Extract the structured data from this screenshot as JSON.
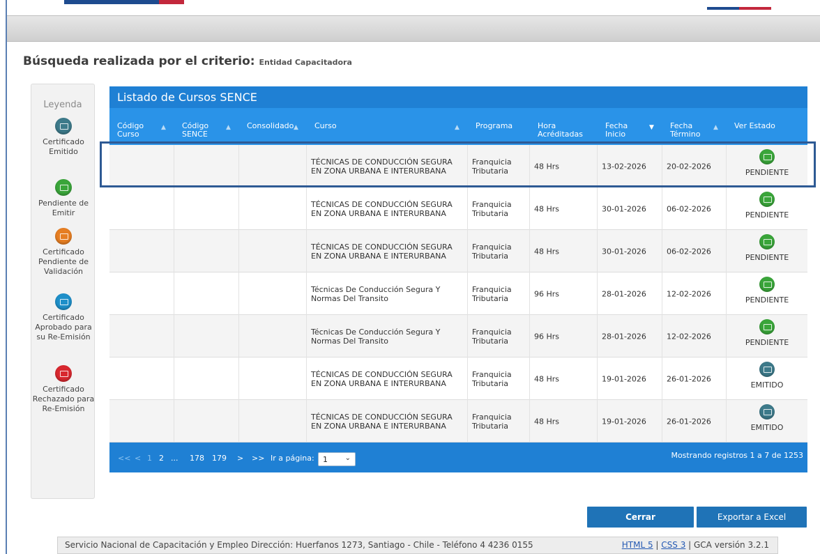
{
  "page": {
    "heading_main": "Búsqueda realizada por el criterio:",
    "heading_criterion": "Entidad Capacitadora"
  },
  "legend": {
    "title": "Leyenda",
    "items": [
      {
        "label": "Certificado Emitido",
        "color": "#3d7a8a",
        "icon": "certificate-emitted-icon"
      },
      {
        "label": "Pendiente de Emitir",
        "color": "#3aa53a",
        "icon": "certificate-pending-icon"
      },
      {
        "label": "Certificado Pendiente de Validación",
        "color": "#e67e22",
        "icon": "certificate-validation-icon"
      },
      {
        "label": "Certificado Aprobado para su Re-Emisión",
        "color": "#1e8fc9",
        "icon": "certificate-approved-icon"
      },
      {
        "label": "Certificado Rechazado para Re-Emisión",
        "color": "#d8282f",
        "icon": "certificate-rejected-icon"
      }
    ]
  },
  "table": {
    "title": "Listado de Cursos SENCE",
    "columns": [
      "Código Curso",
      "Código SENCE",
      "Consolidado",
      "Curso",
      "Programa",
      "Hora Acréditadas",
      "Fecha Inicio",
      "Fecha Término",
      "Ver Estado"
    ],
    "rows": [
      {
        "codigo_curso": "",
        "codigo_sence": "",
        "consolidado": "",
        "curso": "TÉCNICAS DE CONDUCCIÓN SEGURA EN ZONA URBANA E INTERURBANA",
        "programa": "Franquicia Tributaria",
        "horas": "48 Hrs",
        "inicio": "13-02-2026",
        "termino": "20-02-2026",
        "estado": "PENDIENTE",
        "estado_color": "#3aa53a"
      },
      {
        "codigo_curso": "",
        "codigo_sence": "",
        "consolidado": "",
        "curso": "TÉCNICAS DE CONDUCCIÓN SEGURA EN ZONA URBANA E INTERURBANA",
        "programa": "Franquicia Tributaria",
        "horas": "48 Hrs",
        "inicio": "30-01-2026",
        "termino": "06-02-2026",
        "estado": "PENDIENTE",
        "estado_color": "#3aa53a"
      },
      {
        "codigo_curso": "",
        "codigo_sence": "",
        "consolidado": "",
        "curso": "TÉCNICAS DE CONDUCCIÓN SEGURA EN ZONA URBANA E INTERURBANA",
        "programa": "Franquicia Tributaria",
        "horas": "48 Hrs",
        "inicio": "30-01-2026",
        "termino": "06-02-2026",
        "estado": "PENDIENTE",
        "estado_color": "#3aa53a"
      },
      {
        "codigo_curso": "",
        "codigo_sence": "",
        "consolidado": "",
        "curso": "Técnicas De Conducción Segura Y Normas Del Transito",
        "programa": "Franquicia Tributaria",
        "horas": "96 Hrs",
        "inicio": "28-01-2026",
        "termino": "12-02-2026",
        "estado": "PENDIENTE",
        "estado_color": "#3aa53a"
      },
      {
        "codigo_curso": "",
        "codigo_sence": "",
        "consolidado": "",
        "curso": "Técnicas De Conducción Segura Y Normas Del Transito",
        "programa": "Franquicia Tributaria",
        "horas": "96 Hrs",
        "inicio": "28-01-2026",
        "termino": "12-02-2026",
        "estado": "PENDIENTE",
        "estado_color": "#3aa53a"
      },
      {
        "codigo_curso": "",
        "codigo_sence": "",
        "consolidado": "",
        "curso": "TÉCNICAS DE CONDUCCIÓN SEGURA EN ZONA URBANA E INTERURBANA",
        "programa": "Franquicia Tributaria",
        "horas": "48 Hrs",
        "inicio": "19-01-2026",
        "termino": "26-01-2026",
        "estado": "EMITIDO",
        "estado_color": "#3d7a8a"
      },
      {
        "codigo_curso": "",
        "codigo_sence": "",
        "consolidado": "",
        "curso": "TÉCNICAS DE CONDUCCIÓN SEGURA EN ZONA URBANA E INTERURBANA",
        "programa": "Franquicia Tributaria",
        "horas": "48 Hrs",
        "inicio": "19-01-2026",
        "termino": "26-01-2026",
        "estado": "EMITIDO",
        "estado_color": "#3d7a8a"
      }
    ]
  },
  "pager": {
    "first": "<<",
    "prev": "<",
    "pages": [
      "1",
      "2",
      "...",
      "178",
      "179"
    ],
    "next": ">",
    "last": ">>",
    "goto_label": "Ir a página:",
    "selected_page": "1",
    "info": "Mostrando registros 1 a 7 de 1253"
  },
  "buttons": {
    "close": "Cerrar",
    "export": "Exportar a Excel"
  },
  "footer": {
    "text": "Servicio Nacional de Capacitación y Empleo Dirección: Huerfanos 1273, Santiago - Chile - Teléfono 4 4236 0155",
    "html5": "HTML 5",
    "css3": "CSS 3",
    "version": "GCA versión 3.2.1"
  }
}
